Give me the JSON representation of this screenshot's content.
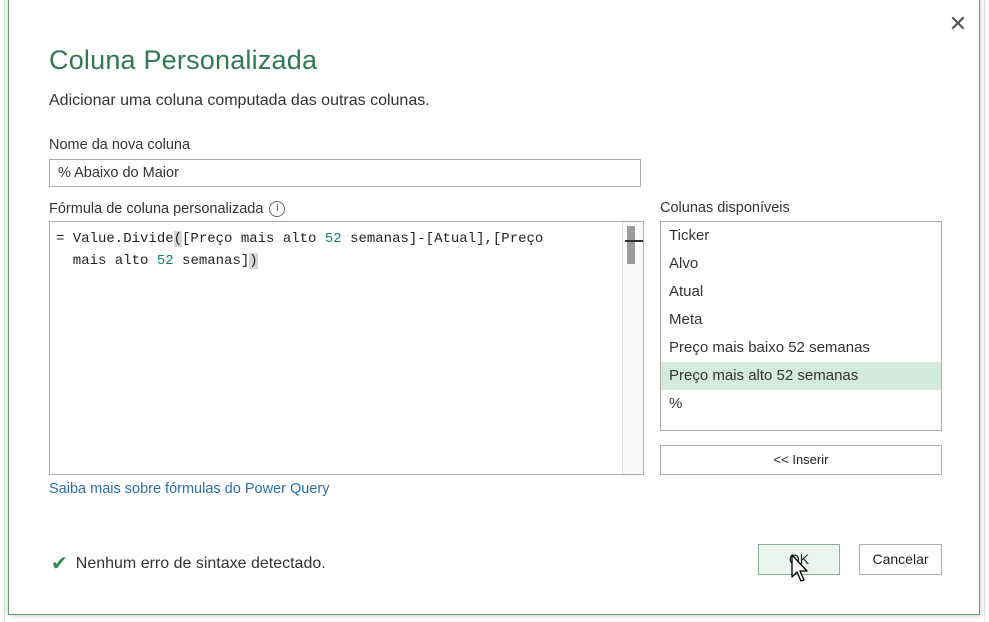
{
  "dialog": {
    "title": "Coluna Personalizada",
    "subtitle": "Adicionar uma coluna computada das outras colunas.",
    "close_glyph": "✕"
  },
  "name_field": {
    "label": "Nome da nova coluna",
    "value": "% Abaixo do Maior"
  },
  "formula": {
    "label": "Fórmula de coluna personalizada",
    "info_glyph": "i",
    "line1_pre": "= Value.Divide",
    "line1_paren": "(",
    "line1_mid": "[Preço mais alto ",
    "line1_num": "52",
    "line1_post": " semanas]-[Atual],[Preço",
    "line2_pre": "  mais alto ",
    "line2_num": "52",
    "line2_mid": " semanas]",
    "line2_paren": ")"
  },
  "learn_more_link": "Saiba mais sobre fórmulas do Power Query",
  "available_columns": {
    "label": "Colunas disponíveis",
    "items": [
      {
        "label": "Ticker",
        "selected": false
      },
      {
        "label": "Alvo",
        "selected": false
      },
      {
        "label": "Atual",
        "selected": false
      },
      {
        "label": "Meta",
        "selected": false
      },
      {
        "label": "Preço mais baixo 52 semanas",
        "selected": false
      },
      {
        "label": "Preço mais alto 52 semanas",
        "selected": true
      },
      {
        "label": "%",
        "selected": false
      }
    ],
    "insert_button": "<< Inserir"
  },
  "status": {
    "icon": "check-icon",
    "text": "Nenhum erro de sintaxe detectado."
  },
  "buttons": {
    "ok": "OK",
    "cancel": "Cancelar"
  },
  "colors": {
    "title": "#2f7a50",
    "selected_row": "#d3ebdd",
    "link": "#2a6ea8",
    "number_literal": "#098658"
  }
}
